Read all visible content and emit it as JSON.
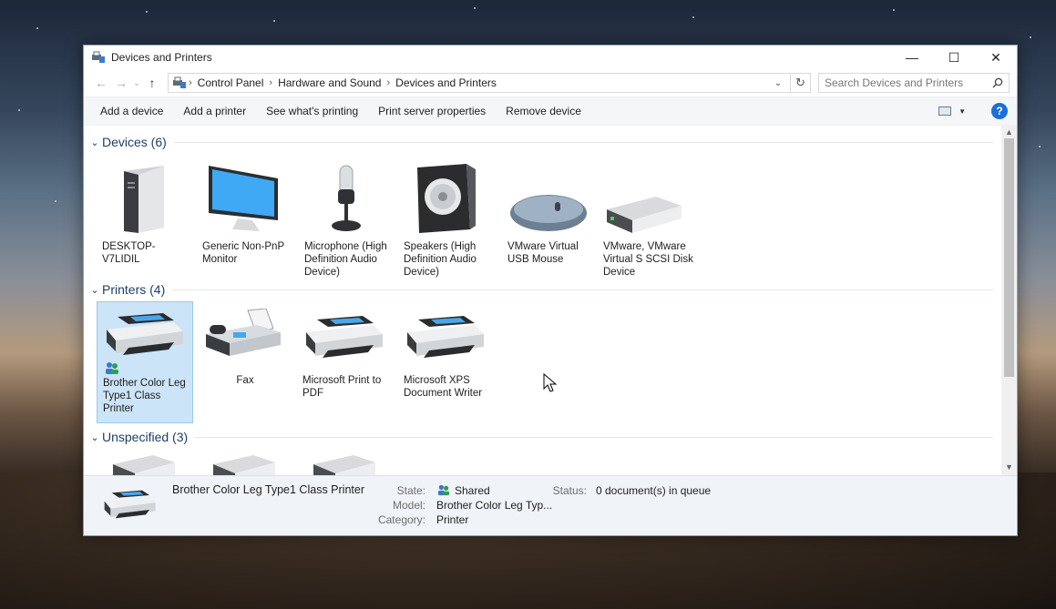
{
  "window": {
    "title": "Devices and Printers",
    "controls": {
      "minimize": "—",
      "maximize": "☐",
      "close": "✕"
    }
  },
  "address": {
    "crumbs": [
      "Control Panel",
      "Hardware and Sound",
      "Devices and Printers"
    ],
    "search_placeholder": "Search Devices and Printers"
  },
  "toolbar": {
    "add_device": "Add a device",
    "add_printer": "Add a printer",
    "see_printing": "See what's printing",
    "print_server": "Print server properties",
    "remove_device": "Remove device",
    "help": "?"
  },
  "groups": {
    "devices": {
      "title": "Devices (6)",
      "items": [
        {
          "label": "DESKTOP-V7LIDIL",
          "icon": "computer-tower-icon"
        },
        {
          "label": "Generic Non-PnP Monitor",
          "icon": "monitor-icon"
        },
        {
          "label": "Microphone (High Definition Audio Device)",
          "icon": "microphone-icon"
        },
        {
          "label": "Speakers (High Definition Audio Device)",
          "icon": "speaker-icon"
        },
        {
          "label": "VMware Virtual USB Mouse",
          "icon": "mouse-icon"
        },
        {
          "label": "VMware, VMware Virtual S SCSI Disk Device",
          "icon": "disk-drive-icon"
        }
      ]
    },
    "printers": {
      "title": "Printers (4)",
      "items": [
        {
          "label": "Brother Color Leg Type1 Class Printer",
          "icon": "printer-icon",
          "selected": true
        },
        {
          "label": "Fax",
          "icon": "fax-icon"
        },
        {
          "label": "Microsoft Print to PDF",
          "icon": "printer-icon"
        },
        {
          "label": "Microsoft XPS Document Writer",
          "icon": "printer-icon"
        }
      ]
    },
    "unspecified": {
      "title": "Unspecified (3)"
    }
  },
  "details": {
    "name": "Brother Color Leg Type1 Class Printer",
    "state_label": "State:",
    "state_value": "Shared",
    "model_label": "Model:",
    "model_value": "Brother Color Leg Typ...",
    "category_label": "Category:",
    "category_value": "Printer",
    "status_label": "Status:",
    "status_value": "0 document(s) in queue"
  },
  "colors": {
    "accent": "#1e3f66",
    "selection": "#cce4f7",
    "help_button": "#1c6fd6"
  }
}
